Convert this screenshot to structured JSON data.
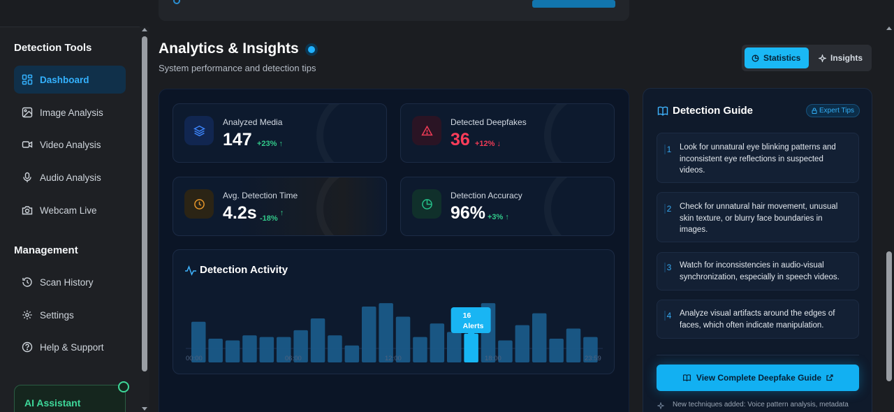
{
  "sidebar": {
    "sections": [
      {
        "title": "Detection Tools",
        "items": [
          {
            "label": "Dashboard",
            "icon": "dashboard-icon",
            "active": true
          },
          {
            "label": "Image Analysis",
            "icon": "image-icon"
          },
          {
            "label": "Video Analysis",
            "icon": "video-icon"
          },
          {
            "label": "Audio Analysis",
            "icon": "microphone-icon"
          },
          {
            "label": "Webcam Live",
            "icon": "camera-icon"
          }
        ]
      },
      {
        "title": "Management",
        "items": [
          {
            "label": "Scan History",
            "icon": "history-icon"
          },
          {
            "label": "Settings",
            "icon": "gear-icon"
          },
          {
            "label": "Help & Support",
            "icon": "help-icon"
          }
        ]
      }
    ],
    "assistant_label": "AI Assistant"
  },
  "header": {
    "title": "Analytics & Insights",
    "subtitle": "System performance and detection tips",
    "tabs": [
      {
        "label": "Statistics",
        "icon": "chart-icon",
        "active": true
      },
      {
        "label": "Insights",
        "icon": "sparkle-icon",
        "active": false
      }
    ]
  },
  "stats": [
    {
      "label": "Analyzed Media",
      "value": "147",
      "delta": "+23%",
      "trend": "up",
      "icon": "layers-icon",
      "accent": "#2f7df6",
      "valueColor": "#ffffff",
      "deltaColor": "#32c98a"
    },
    {
      "label": "Detected Deepfakes",
      "value": "36",
      "delta": "+12%",
      "trend": "down",
      "icon": "warning-icon",
      "accent": "#ef3b56",
      "valueColor": "#ff3d5a",
      "deltaColor": "#ef3b56"
    },
    {
      "label": "Avg. Detection Time",
      "value": "4.2s",
      "delta": "-18%",
      "trend": "up",
      "icon": "clock-icon",
      "accent": "#e8972a",
      "valueColor": "#ffffff",
      "deltaColor": "#32c98a"
    },
    {
      "label": "Detection Accuracy",
      "value": "96%",
      "delta": "+3%",
      "trend": "up",
      "icon": "pie-icon",
      "accent": "#25c08a",
      "valueColor": "#ffffff",
      "deltaColor": "#32c98a"
    }
  ],
  "activity": {
    "title": "Detection Activity",
    "tooltip": {
      "value": "16",
      "unit": "Alerts"
    }
  },
  "chart_data": {
    "type": "bar",
    "title": "Detection Activity",
    "x_ticks": [
      "00:00",
      "06:00",
      "12:00",
      "18:00",
      "23:59"
    ],
    "values": [
      12,
      7,
      6.5,
      8,
      7.5,
      7.5,
      9.5,
      13,
      8,
      5,
      16.5,
      17.5,
      13.5,
      7.5,
      11.5,
      9,
      8.5,
      17.5,
      6.5,
      11,
      14.5,
      7,
      10,
      7.5
    ],
    "highlight_index": 16,
    "highlight_label": "16 Alerts"
  },
  "guide": {
    "title": "Detection Guide",
    "badge": "Expert Tips",
    "tips": [
      {
        "n": "1",
        "text": "Look for unnatural eye blinking patterns and inconsistent eye reflections in suspected videos."
      },
      {
        "n": "2",
        "text": "Check for unnatural hair movement, unusual skin texture, or blurry face boundaries in images."
      },
      {
        "n": "3",
        "text": "Watch for inconsistencies in audio-visual synchronization, especially in speech videos."
      },
      {
        "n": "4",
        "text": "Analyze visual artifacts around the edges of faces, which often indicate manipulation."
      }
    ],
    "cta": "View Complete Deepfake Guide",
    "note": "New techniques added: Voice pattern analysis, metadata"
  }
}
